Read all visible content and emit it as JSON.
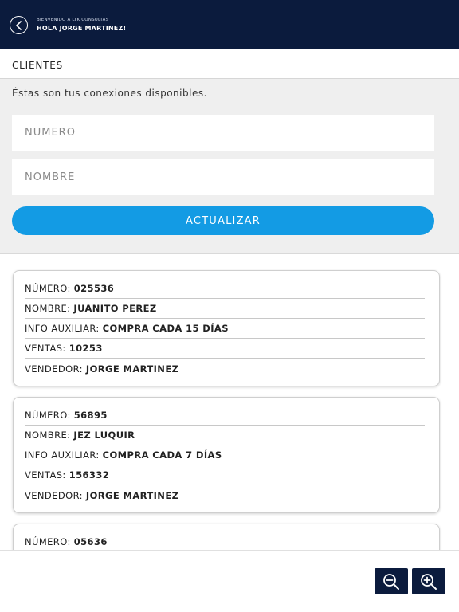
{
  "header": {
    "welcome_small": "BIENVENIDO A LTK CONSULTAS",
    "welcome_big": "HOLA JORGE MARTINEZ!",
    "back_icon": "chevron-left-circle-icon"
  },
  "section": {
    "title": "CLIENTES"
  },
  "filters": {
    "intro": "Éstas son tus conexiones disponibles.",
    "numero_placeholder": "NÚMERO",
    "numero_value": "",
    "nombre_placeholder": "NOMBRE",
    "nombre_value": "",
    "update_label": "ACTUALIZAR"
  },
  "labels": {
    "numero": "NÚMERO:",
    "nombre": "NOMBRE:",
    "info": "INFO AUXILIAR:",
    "ventas": "VENTAS:",
    "vendedor": "VENDEDOR:"
  },
  "clients": [
    {
      "numero": "025536",
      "nombre": "JUANITO PEREZ",
      "info": "COMPRA CADA 15 DÍAS",
      "ventas": "10253",
      "vendedor": "JORGE MARTINEZ"
    },
    {
      "numero": "56895",
      "nombre": "JEZ LUQUIR",
      "info": "COMPRA CADA 7 DÍAS",
      "ventas": "156332",
      "vendedor": "JORGE MARTINEZ"
    },
    {
      "numero": "05636"
    }
  ],
  "zoom": {
    "out_icon": "zoom-out-icon",
    "in_icon": "zoom-in-icon"
  },
  "colors": {
    "navy": "#0b1b3d",
    "accent": "#139be4",
    "panel": "#efefef"
  }
}
